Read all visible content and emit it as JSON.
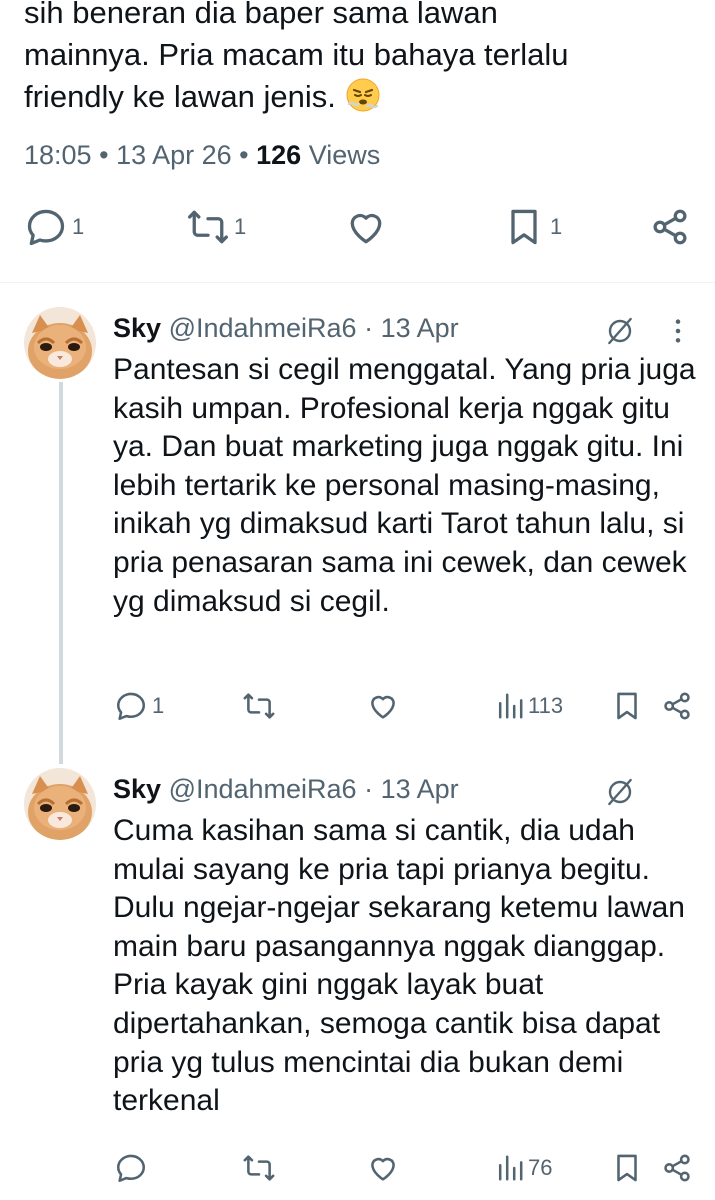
{
  "main_tweet": {
    "text_lines": [
      "sih beneran dia baper sama lawan",
      "mainnya. Pria macam itu bahaya terlalu",
      "friendly ke lawan jenis."
    ],
    "emoji": "huffing-face-emoji",
    "time": "18:05",
    "date": "13 Apr 26",
    "views_count": "126",
    "views_label": "Views",
    "actions": {
      "replies": "1",
      "reposts": "1",
      "bookmarks": "1"
    }
  },
  "replies": [
    {
      "name": "Sky",
      "handle": "@IndahmeiRa6",
      "date": "13 Apr",
      "text": "Pantesan si cegil menggatal. Yang pria juga kasih umpan. Profesional kerja nggak gitu ya. Dan buat marketing juga nggak gitu. Ini lebih tertarik ke personal masing-masing, inikah yg dimaksud karti Tarot tahun lalu, si pria penasaran sama ini cewek, dan cewek yg dimaksud si cegil.",
      "replies": "1",
      "views": "113"
    },
    {
      "name": "Sky",
      "handle": "@IndahmeiRa6",
      "date": "13 Apr",
      "text": "Cuma kasihan sama si cantik, dia udah mulai sayang ke pria tapi prianya begitu. Dulu ngejar-ngejar sekarang ketemu lawan main baru pasangannya nggak dianggap. Pria kayak gini nggak layak buat dipertahankan, semoga cantik bisa dapat pria yg tulus mencintai dia bukan demi terkenal",
      "replies": "",
      "views": "76"
    }
  ],
  "colors": {
    "text": "#0f1419",
    "secondary": "#536471",
    "thread_line": "#cfd9de",
    "divider": "#eff3f4"
  }
}
